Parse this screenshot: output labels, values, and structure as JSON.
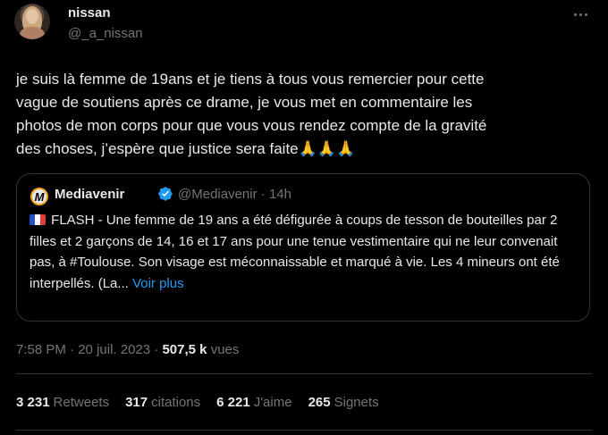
{
  "author": {
    "display_name": "nissan",
    "handle": "@_a_nissan"
  },
  "tweet": {
    "text": "je suis là femme de 19ans et je tiens à tous vous remercier pour cette\nvague de soutiens après ce drame, je vous met en commentaire les\nphotos de mon corps pour que vous vous rendez compte de la gravité\ndes choses, j’espère que justice sera faite",
    "emoji": "🙏🙏🙏"
  },
  "quote": {
    "display_name": "Mediavenir",
    "handle": "@Mediavenir",
    "separator": "·",
    "time_ago": "14h",
    "text": "FLASH - Une femme de 19 ans a été défigurée à coups de tesson de bouteilles par 2 filles et 2 garçons de 14, 16 et 17 ans pour une tenue vestimentaire qui ne leur convenait pas, à #Toulouse. Son visage est méconnaissable et marqué à vie. Les 4 mineurs ont été interpellés. (La...",
    "show_more": "Voir plus",
    "logo_letter": "M"
  },
  "meta": {
    "time": "7:58 PM",
    "date": "20 juil. 2023",
    "views_count": "507,5 k",
    "views_label": "vues",
    "separator": "·"
  },
  "stats": [
    {
      "count": "3 231",
      "label": "Retweets"
    },
    {
      "count": "317",
      "label": "citations"
    },
    {
      "count": "6 221",
      "label": "J'aime"
    },
    {
      "count": "265",
      "label": "Signets"
    }
  ],
  "colors": {
    "background": "#000000",
    "text": "#e7e9ea",
    "muted": "#71767b",
    "accent": "#1d9bf0",
    "border": "#2f3336"
  }
}
